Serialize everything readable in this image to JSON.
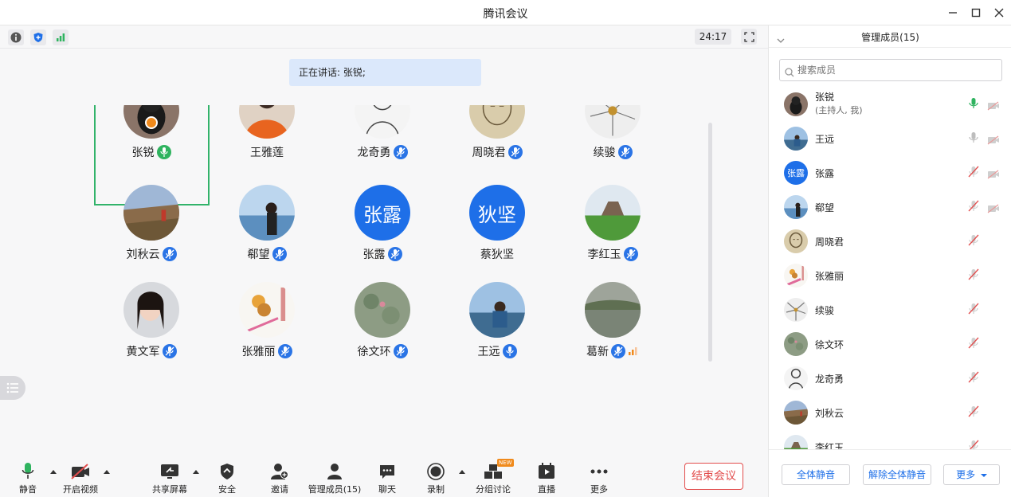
{
  "window": {
    "title": "腾讯会议"
  },
  "meeting": {
    "timer": "24:17",
    "speaking_text": "正在讲话: 张锐;",
    "participants": [
      {
        "name": "张锐",
        "row": 0,
        "col": 0,
        "mic": "green",
        "avatar": "photo-cat"
      },
      {
        "name": "王雅莲",
        "row": 0,
        "col": 1,
        "mic": "none",
        "avatar": "photo-orange"
      },
      {
        "name": "龙奇勇",
        "row": 0,
        "col": 2,
        "mic": "muted",
        "avatar": "drawing"
      },
      {
        "name": "周晓君",
        "row": 0,
        "col": 3,
        "mic": "muted",
        "avatar": "sketch"
      },
      {
        "name": "续骏",
        "row": 0,
        "col": 4,
        "mic": "muted",
        "avatar": "flower"
      },
      {
        "name": "刘秋云",
        "row": 1,
        "col": 0,
        "mic": "muted",
        "avatar": "landscape"
      },
      {
        "name": "郗望",
        "row": 1,
        "col": 1,
        "mic": "muted",
        "avatar": "beach"
      },
      {
        "name": "张露",
        "row": 1,
        "col": 2,
        "mic": "muted",
        "avatar": "initials",
        "initials": "张露"
      },
      {
        "name": "蔡狄坚",
        "row": 1,
        "col": 3,
        "mic": "none",
        "avatar": "initials",
        "initials": "狄坚"
      },
      {
        "name": "李红玉",
        "row": 1,
        "col": 4,
        "mic": "muted",
        "avatar": "garden"
      },
      {
        "name": "黄文军",
        "row": 2,
        "col": 0,
        "mic": "muted",
        "avatar": "woman"
      },
      {
        "name": "张雅丽",
        "row": 2,
        "col": 1,
        "mic": "muted",
        "avatar": "book"
      },
      {
        "name": "徐文环",
        "row": 2,
        "col": 2,
        "mic": "muted",
        "avatar": "lotus"
      },
      {
        "name": "王远",
        "row": 2,
        "col": 3,
        "mic": "active",
        "avatar": "lake"
      },
      {
        "name": "葛新",
        "row": 2,
        "col": 4,
        "mic": "muted-signal",
        "avatar": "pond"
      }
    ]
  },
  "toolbar": {
    "mute": "静音",
    "video": "开启视频",
    "share": "共享屏幕",
    "security": "安全",
    "invite": "邀请",
    "members": "管理成员(15)",
    "chat": "聊天",
    "record": "录制",
    "breakout": "分组讨论",
    "breakout_badge": "NEW",
    "live": "直播",
    "more": "更多",
    "end": "结束会议"
  },
  "panel": {
    "title": "管理成员(15)",
    "search_placeholder": "搜索成员",
    "members": [
      {
        "name": "张锐",
        "sub": "(主持人, 我)",
        "avatar": "photo-cat",
        "mic": "green",
        "video": "off"
      },
      {
        "name": "王远",
        "sub": "",
        "avatar": "lake",
        "mic": "gray",
        "video": "off"
      },
      {
        "name": "张露",
        "sub": "",
        "avatar": "initials",
        "initials": "张露",
        "mic": "muted",
        "video": "off"
      },
      {
        "name": "郗望",
        "sub": "",
        "avatar": "beach",
        "mic": "muted",
        "video": "off"
      },
      {
        "name": "周晓君",
        "sub": "",
        "avatar": "sketch",
        "mic": "muted",
        "video": ""
      },
      {
        "name": "张雅丽",
        "sub": "",
        "avatar": "book",
        "mic": "muted",
        "video": ""
      },
      {
        "name": "续骏",
        "sub": "",
        "avatar": "flower",
        "mic": "muted",
        "video": ""
      },
      {
        "name": "徐文环",
        "sub": "",
        "avatar": "lotus",
        "mic": "muted",
        "video": ""
      },
      {
        "name": "龙奇勇",
        "sub": "",
        "avatar": "drawing",
        "mic": "muted",
        "video": ""
      },
      {
        "name": "刘秋云",
        "sub": "",
        "avatar": "landscape",
        "mic": "muted",
        "video": ""
      },
      {
        "name": "李红玉",
        "sub": "",
        "avatar": "garden",
        "mic": "muted",
        "video": ""
      }
    ],
    "mute_all": "全体静音",
    "unmute_all": "解除全体静音",
    "more": "更多"
  }
}
